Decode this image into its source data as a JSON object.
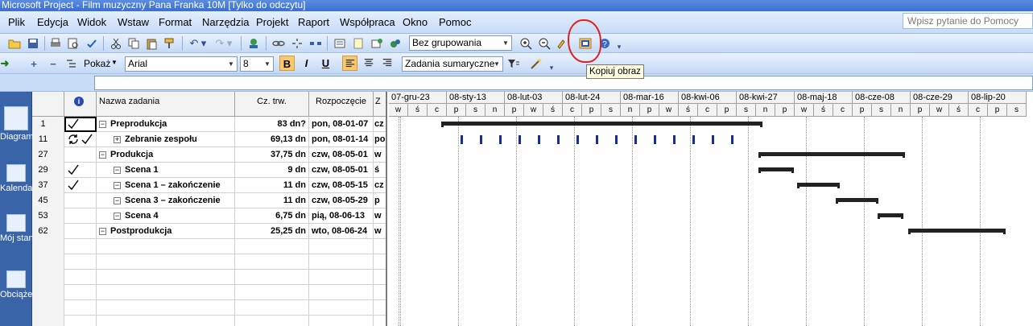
{
  "title": "Microsoft Project - Film muzyczny Pana Franka 10M [Tylko do odczytu]",
  "menu": [
    "Plik",
    "Edycja",
    "Widok",
    "Wstaw",
    "Format",
    "Narzędzia",
    "Projekt",
    "Raport",
    "Współpraca",
    "Okno",
    "Pomoc"
  ],
  "help_placeholder": "Wpisz pytanie do Pomocy",
  "toolbar": {
    "grouping": "Bez grupowania",
    "show_label": "Pokaż",
    "font": "Arial",
    "font_size": "8",
    "bold": "B",
    "italic": "I",
    "underline": "U",
    "filter": "Zadania sumaryczne",
    "tooltip": "Kopiuj obraz"
  },
  "viewbar": [
    "Wykres Gantta",
    "Diagram sieciowy",
    "Kalendarz",
    "Mój standard",
    "Obciążenie zadaniami"
  ],
  "columns": {
    "info": "i",
    "name": "Nazwa zadania",
    "duration": "Cz. trw.",
    "start": "Rozpoczęcie",
    "extra": "Z"
  },
  "tasks": [
    {
      "id": "1",
      "name": "Preprodukcja",
      "duration": "83 dn?",
      "start": "pon, 08-01-07",
      "extra": "cz",
      "indent": 0,
      "expander": "−",
      "check": true,
      "recurring": false
    },
    {
      "id": "11",
      "name": "Zebranie zespołu",
      "duration": "69,13 dn",
      "start": "pon, 08-01-14",
      "extra": "po",
      "indent": 1,
      "expander": "+",
      "check": true,
      "recurring": true
    },
    {
      "id": "27",
      "name": "Produkcja",
      "duration": "37,75 dn",
      "start": "czw, 08-05-01",
      "extra": "w",
      "indent": 0,
      "expander": "−",
      "check": false,
      "recurring": false
    },
    {
      "id": "29",
      "name": "Scena 1",
      "duration": "9 dn",
      "start": "czw, 08-05-01",
      "extra": "ś",
      "indent": 1,
      "expander": "−",
      "check": true,
      "recurring": false
    },
    {
      "id": "37",
      "name": "Scena 1 – zakończenie",
      "duration": "11 dn",
      "start": "czw, 08-05-15",
      "extra": "cz",
      "indent": 1,
      "expander": "−",
      "check": true,
      "recurring": false
    },
    {
      "id": "45",
      "name": "Scena 3 – zakończenie",
      "duration": "11 dn",
      "start": "czw, 08-05-29",
      "extra": "p",
      "indent": 1,
      "expander": "−",
      "check": false,
      "recurring": false
    },
    {
      "id": "53",
      "name": "Scena 4",
      "duration": "6,75 dn",
      "start": "pią, 08-06-13",
      "extra": "w",
      "indent": 1,
      "expander": "−",
      "check": false,
      "recurring": false
    },
    {
      "id": "62",
      "name": "Postprodukcja",
      "duration": "25,25 dn",
      "start": "wto, 08-06-24",
      "extra": "w",
      "indent": 0,
      "expander": "−",
      "check": false,
      "recurring": false
    }
  ],
  "gantt": {
    "weeks": [
      "07-gru-23",
      "08-sty-13",
      "08-lut-03",
      "08-lut-24",
      "08-mar-16",
      "08-kwi-06",
      "08-kwi-27",
      "08-maj-18",
      "08-cze-08",
      "08-cze-29",
      "08-lip-20"
    ],
    "days": [
      "w",
      "ś",
      "c",
      "p",
      "s",
      "n",
      "p",
      "w",
      "ś",
      "c",
      "p",
      "s",
      "n",
      "p",
      "w",
      "ś",
      "c",
      "p",
      "s",
      "n",
      "p",
      "w",
      "ś",
      "c",
      "p",
      "s",
      "n",
      "p",
      "w",
      "ś",
      "c",
      "p",
      "s"
    ]
  }
}
